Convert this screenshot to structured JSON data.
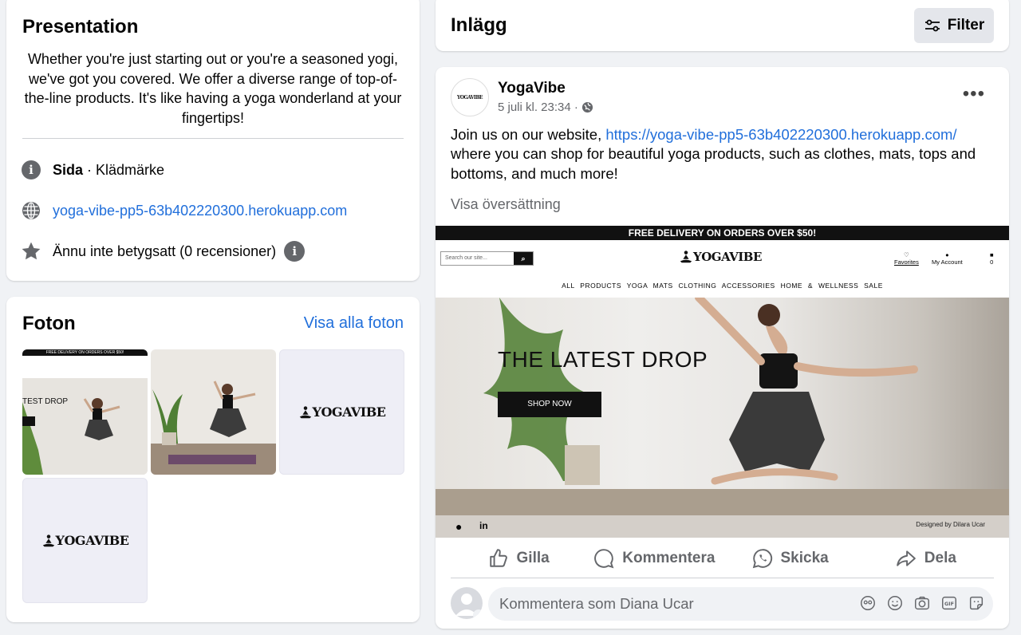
{
  "presentation": {
    "title": "Presentation",
    "bio": "Whether you're just starting out or you're a seasoned yogi, we've got you covered. We offer a diverse range of top-of-the-line products. It's like having a yoga wonderland at your fingertips!",
    "page_type_bold": "Sida",
    "page_type_rest": " · Klädmärke",
    "website": "yoga-vibe-pp5-63b402220300.herokuapp.com",
    "rating": "Ännu inte betygsatt (0 recensioner)"
  },
  "photos": {
    "title": "Foton",
    "see_all": "Visa alla foton",
    "logo_text": "YOGAVIBE",
    "thumb_banner": "FREE DELIVERY ON ORDERS OVER $50!",
    "thumb_drop": "TEST DROP"
  },
  "posts": {
    "title": "Inlägg",
    "filter_label": "Filter"
  },
  "post": {
    "author": "YogaVibe",
    "timestamp": "5 juli kl. 23:34 ·",
    "text_before": "Join us on our website, ",
    "link": "https://yoga-vibe-pp5-63b402220300.herokuapp.com/",
    "text_after": " where you can shop for beautiful yoga products, such as clothes, mats, tops and bottoms, and much more!",
    "translate": "Visa översättning",
    "more": "•••",
    "avatar_logo": "YOGAVIBE"
  },
  "website_preview": {
    "banner": "FREE DELIVERY ON ORDERS OVER $50!",
    "search_placeholder": "Search our site...",
    "logo": "YOGAVIBE",
    "favorites": "Favorites",
    "account": "My Account",
    "cart_count": "0",
    "nav": "ALL PRODUCTS   YOGA MATS   CLOTHING   ACCESSORIES   HOME & WELLNESS   SALE",
    "hero_title": "THE LATEST DROP",
    "shop_button": "SHOP NOW",
    "credit": "Designed by Dilara Ucar"
  },
  "actions": {
    "like": "Gilla",
    "comment": "Kommentera",
    "send": "Skicka",
    "share": "Dela"
  },
  "comment": {
    "placeholder": "Kommentera som Diana Ucar"
  },
  "colors": {
    "link": "#216fdb",
    "secondary_text": "#65676b",
    "background": "#f0f2f5"
  }
}
